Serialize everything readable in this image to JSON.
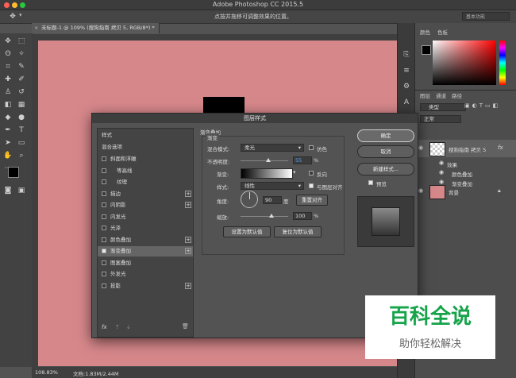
{
  "app": {
    "title": "Adobe Photoshop CC 2015.5"
  },
  "options_bar": {
    "hint": "点按并拖移可调整效果的位置。",
    "workspace": "基本功能"
  },
  "document": {
    "tab_title": "未标题-1 @ 109% (搜狗指南 拷贝 5, RGB/8*) *",
    "zoom": "108.83%",
    "doc_size": "文档:1.83M/2.44M"
  },
  "panels": {
    "color_tabs": [
      "颜色",
      "色板"
    ],
    "layer_tabs": [
      "图层",
      "通道",
      "路径"
    ],
    "layer_kind": "类型",
    "blend_mode": "正常",
    "layers": [
      {
        "name": "搜狗指南 拷贝 5",
        "fx": "fx"
      },
      {
        "name": "效果"
      },
      {
        "name": "颜色叠加"
      },
      {
        "name": "渐变叠加"
      },
      {
        "name": "背景"
      }
    ],
    "colors": {
      "background_layer_thumb": "#d6878a",
      "canvas": "#d6878a"
    }
  },
  "dialog": {
    "title": "图层样式",
    "styles_header": "样式",
    "blend_options": "混合选项",
    "items": [
      {
        "label": "斜面和浮雕",
        "checked": false,
        "plus": false
      },
      {
        "label": "等高线",
        "checked": false,
        "plus": false
      },
      {
        "label": "纹理",
        "checked": false,
        "plus": false
      },
      {
        "label": "描边",
        "checked": false,
        "plus": true
      },
      {
        "label": "内阴影",
        "checked": false,
        "plus": true
      },
      {
        "label": "内发光",
        "checked": false,
        "plus": false
      },
      {
        "label": "光泽",
        "checked": false,
        "plus": false
      },
      {
        "label": "颜色叠加",
        "checked": false,
        "plus": true
      },
      {
        "label": "渐变叠加",
        "checked": true,
        "plus": true
      },
      {
        "label": "图案叠加",
        "checked": false,
        "plus": false
      },
      {
        "label": "外发光",
        "checked": false,
        "plus": false
      },
      {
        "label": "投影",
        "checked": false,
        "plus": true
      }
    ],
    "fx_label": "fx",
    "section_title": "渐变叠加",
    "subsection": "渐变",
    "blend_mode_label": "混合模式:",
    "blend_mode_value": "柔光",
    "dither_label": "仿色",
    "opacity_label": "不透明度:",
    "opacity_value": "55",
    "percent": "%",
    "gradient_label": "渐变:",
    "reverse_label": "反向",
    "style_label": "样式:",
    "style_value": "线性",
    "align_label": "与图层对齐",
    "angle_label": "角度:",
    "angle_value": "90",
    "degree": "度",
    "reset_align": "重置对齐",
    "scale_label": "缩放:",
    "scale_value": "100",
    "set_default": "设置为默认值",
    "reset_default": "复位为默认值",
    "ok": "确定",
    "cancel": "取消",
    "new_style": "新建样式...",
    "preview_label": "预览"
  },
  "watermark": {
    "big": "百科全说",
    "small": "助你轻松解决"
  }
}
